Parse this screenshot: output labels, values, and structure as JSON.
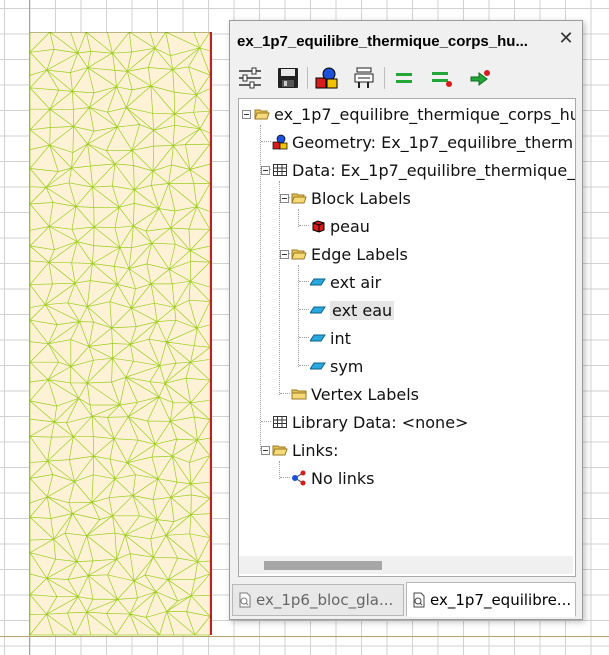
{
  "panel": {
    "title": "ex_1p7_equilibre_thermique_corps_hu...",
    "close_glyph": "✕"
  },
  "toolbar": [
    {
      "name": "sliders-icon"
    },
    {
      "name": "save-icon"
    },
    {
      "name": "geometry-shapes-icon"
    },
    {
      "name": "solver-icon"
    },
    {
      "name": "equal-icon"
    },
    {
      "name": "equal-arrow-icon"
    },
    {
      "name": "run-icon"
    }
  ],
  "tree": {
    "root": "ex_1p7_equilibre_thermique_corps_hu",
    "geometry": "Geometry: Ex_1p7_equilibre_therm",
    "data": "Data: Ex_1p7_equilibre_thermique_",
    "block_labels": "Block Labels",
    "peau": "peau",
    "edge_labels": "Edge Labels",
    "ext_air": "ext air",
    "ext_eau": "ext eau",
    "int": "int",
    "sym": "sym",
    "vertex_labels": "Vertex Labels",
    "library_data": "Library Data: <none>",
    "links": "Links:",
    "no_links": "No links"
  },
  "tabs": [
    {
      "label": "ex_1p6_bloc_gla...",
      "active": false
    },
    {
      "label": "ex_1p7_equilibre...",
      "active": true
    }
  ],
  "colors": {
    "mesh_fill": "#fdf2d6",
    "mesh_line": "#9ccc1e",
    "boundary_red": "#c02020",
    "selection": "#e5e5e5"
  }
}
